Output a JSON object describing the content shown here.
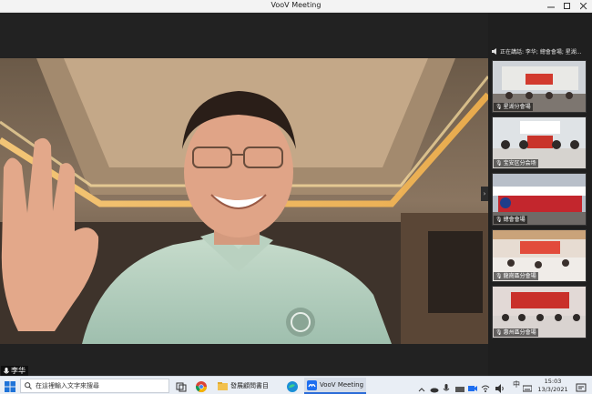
{
  "window": {
    "title": "VooV Meeting"
  },
  "main_video": {
    "speaker_name": "李华"
  },
  "sidebar": {
    "speaking_text": "正在講話: 李华; 總會會場; 星湖...",
    "thumbnails": [
      {
        "label": "星湖分會場"
      },
      {
        "label": "宝安区分会场"
      },
      {
        "label": "總會會場"
      },
      {
        "label": "龍崗區分會場"
      },
      {
        "label": "惠州區分會場"
      }
    ],
    "collapse_glyph": "›"
  },
  "taskbar": {
    "search_placeholder": "在這裡輸入文字來搜尋",
    "apps": [
      {
        "label": "發展顧問書目"
      },
      {
        "label": "VooV Meeting"
      }
    ],
    "language": "中",
    "time": "15:03",
    "date": "13/3/2021"
  }
}
